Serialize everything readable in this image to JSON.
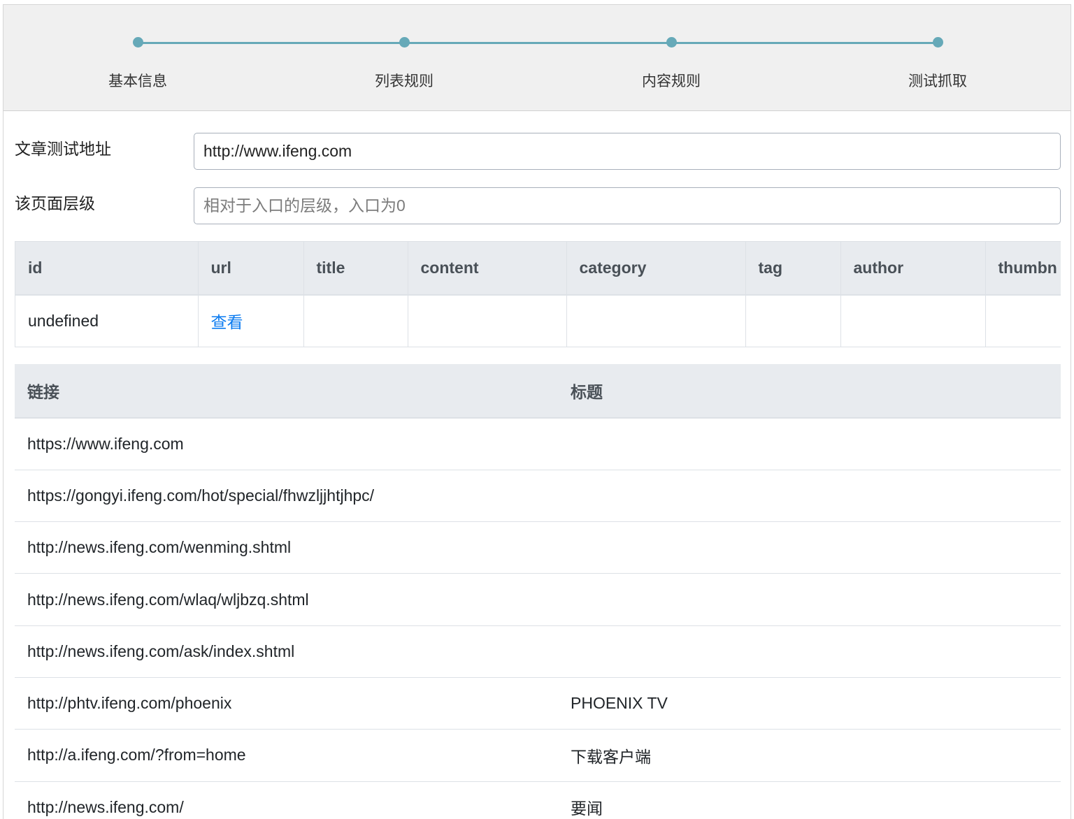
{
  "steps": [
    {
      "label": "基本信息"
    },
    {
      "label": "列表规则"
    },
    {
      "label": "内容规则"
    },
    {
      "label": "测试抓取"
    }
  ],
  "colors": {
    "accent": "#66a9b8",
    "link": "#0b7bf0",
    "header_bg": "#e8ebef"
  },
  "form": {
    "url_label": "文章测试地址",
    "url_value": "http://www.ifeng.com",
    "level_label": "该页面层级",
    "level_placeholder": "相对于入口的层级，入口为0",
    "level_value": ""
  },
  "result_table": {
    "columns": [
      "id",
      "url",
      "title",
      "content",
      "category",
      "tag",
      "author",
      "thumbn"
    ],
    "row": {
      "id": "undefined",
      "url_link": "查看",
      "title": "",
      "content": "",
      "category": "",
      "tag": "",
      "author": "",
      "thumbn": ""
    }
  },
  "links_table": {
    "columns": [
      "链接",
      "标题"
    ],
    "rows": [
      {
        "link": "https://www.ifeng.com",
        "title": ""
      },
      {
        "link": "https://gongyi.ifeng.com/hot/special/fhwzljjhtjhpc/",
        "title": ""
      },
      {
        "link": "http://news.ifeng.com/wenming.shtml",
        "title": ""
      },
      {
        "link": "http://news.ifeng.com/wlaq/wljbzq.shtml",
        "title": ""
      },
      {
        "link": "http://news.ifeng.com/ask/index.shtml",
        "title": ""
      },
      {
        "link": "http://phtv.ifeng.com/phoenix",
        "title": "PHOENIX TV"
      },
      {
        "link": "http://a.ifeng.com/?from=home",
        "title": "下载客户端"
      },
      {
        "link": "http://news.ifeng.com/",
        "title": "要闻"
      }
    ]
  }
}
